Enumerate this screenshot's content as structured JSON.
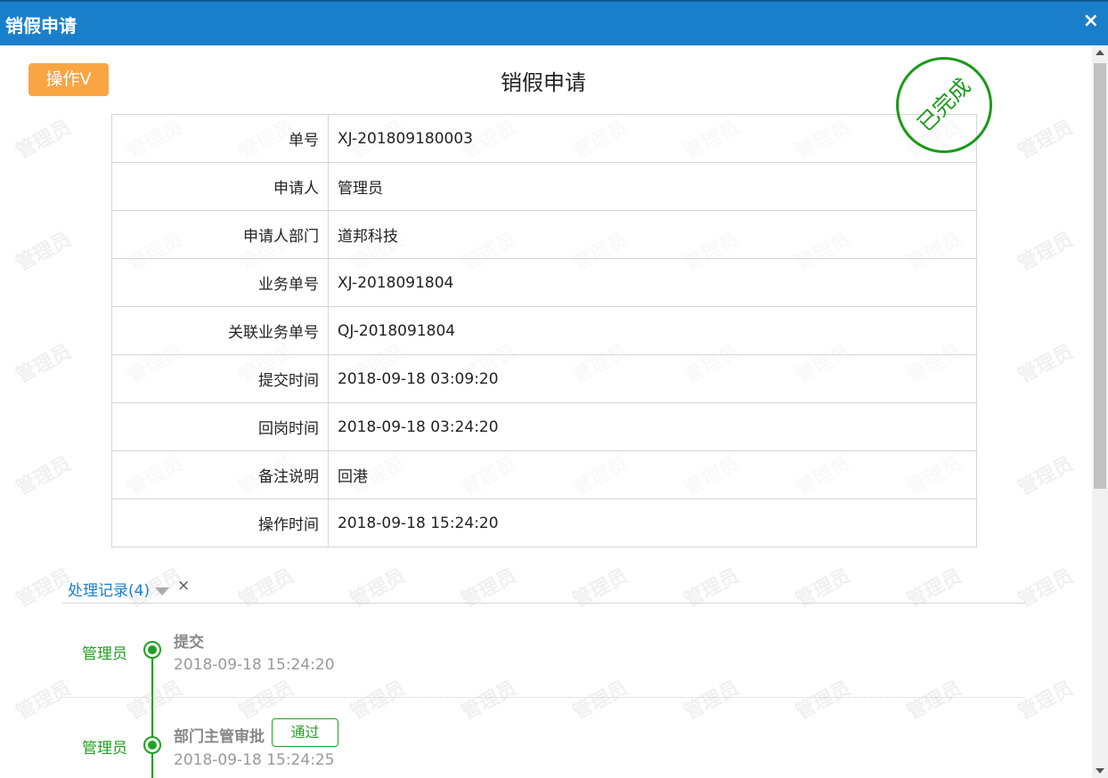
{
  "window": {
    "title": "销假申请",
    "close_icon": "×"
  },
  "toolbar": {
    "op_label": "操作V"
  },
  "page": {
    "title": "销假申请"
  },
  "stamp": {
    "text": "已完成",
    "color": "#1a9a1a"
  },
  "watermark": {
    "text": "管理员"
  },
  "fields": [
    {
      "label": "单号",
      "value": "XJ-201809180003"
    },
    {
      "label": "申请人",
      "value": "管理员"
    },
    {
      "label": "申请人部门",
      "value": "道邦科技"
    },
    {
      "label": "业务单号",
      "value": "XJ-2018091804"
    },
    {
      "label": "关联业务单号",
      "value": "QJ-2018091804"
    },
    {
      "label": "提交时间",
      "value": "2018-09-18 03:09:20"
    },
    {
      "label": "回岗时间",
      "value": "2018-09-18 03:24:20"
    },
    {
      "label": "备注说明",
      "value": "回港"
    },
    {
      "label": "操作时间",
      "value": "2018-09-18 15:24:20"
    }
  ],
  "records": {
    "header": "处理记录(4)",
    "close": "×",
    "items": [
      {
        "user": "管理员",
        "action": "提交",
        "time": "2018-09-18 15:24:20",
        "badge": ""
      },
      {
        "user": "管理员",
        "action": "部门主管审批",
        "time": "2018-09-18 15:24:25",
        "badge": "通过"
      }
    ]
  },
  "colors": {
    "titlebar": "#1a7fcb",
    "op_button": "#f9a543",
    "accent_green": "#22a022"
  }
}
